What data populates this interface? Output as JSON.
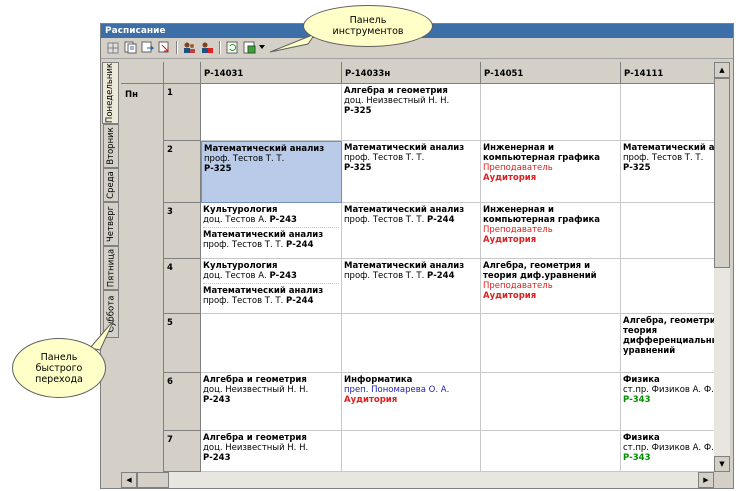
{
  "window": {
    "title": "Расписание"
  },
  "toolbar": {
    "icons": [
      "grid-icon",
      "copy-icon",
      "export-icon",
      "import-icon",
      "users-icon",
      "user-edit-icon",
      "refresh-icon",
      "save-icon",
      "dropdown-arrow-icon"
    ]
  },
  "callouts": {
    "toolbar": "Панель\nинструментов",
    "quicknav": "Панель\nбыстрого\nперехода"
  },
  "days": [
    "Понедельник",
    "Вторник",
    "Среда",
    "Четверг",
    "Пятница",
    "Суббота"
  ],
  "active_day": "Понедельник",
  "grid": {
    "day_label": "Пн",
    "columns": [
      "Р-14031",
      "Р-14033н",
      "Р-14051",
      "Р-14111"
    ],
    "rows": [
      {
        "num": "1",
        "cells": [
          null,
          {
            "entries": [
              {
                "subject": "Алгебра и геометрия",
                "teacher": "доц. Неизвестный Н. Н.",
                "room": "Р-325"
              }
            ]
          },
          null,
          null
        ]
      },
      {
        "num": "2",
        "cells": [
          {
            "selected": true,
            "entries": [
              {
                "subject": "Математический анализ",
                "teacher": "проф. Тестов Т. Т.",
                "room": "Р-325"
              }
            ]
          },
          {
            "entries": [
              {
                "subject": "Математический анализ",
                "teacher": "проф. Тестов Т. Т.",
                "room": "Р-325"
              }
            ]
          },
          {
            "entries": [
              {
                "subject": "Инженерная и",
                "subject2": "компьютерная графика",
                "teacher_red": "Преподаватель",
                "room_red": "Аудитория"
              }
            ]
          },
          {
            "entries": [
              {
                "subject": "Математический ан",
                "teacher": "проф. Тестов Т. Т.",
                "room": "Р-325"
              }
            ]
          }
        ]
      },
      {
        "num": "3",
        "cells": [
          {
            "entries": [
              {
                "subject": "Культурология",
                "teacher": "доц. Тестов А.",
                "room_inline": "Р-243"
              },
              {
                "subject": "Математический анализ",
                "teacher": "проф. Тестов Т. Т.",
                "room_inline": "Р-244"
              }
            ]
          },
          {
            "entries": [
              {
                "subject": "Математический анализ",
                "teacher": "проф. Тестов Т. Т.",
                "room_inline": "Р-244"
              }
            ]
          },
          {
            "entries": [
              {
                "subject": "Инженерная и",
                "subject2": "компьютерная графика",
                "teacher_red": "Преподаватель",
                "room_red": "Аудитория"
              }
            ]
          },
          null
        ]
      },
      {
        "num": "4",
        "cells": [
          {
            "entries": [
              {
                "subject": "Культурология",
                "teacher": "доц. Тестов А.",
                "room_inline": "Р-243"
              },
              {
                "subject": "Математический анализ",
                "teacher": "проф. Тестов Т. Т.",
                "room_inline": "Р-244"
              }
            ]
          },
          {
            "entries": [
              {
                "subject": "Математический анализ",
                "teacher": "проф. Тестов Т. Т.",
                "room_inline": "Р-244"
              }
            ]
          },
          {
            "entries": [
              {
                "subject": "Алгебра, геометрия и",
                "subject2": "теория диф.уравнений",
                "teacher_red": "Преподаватель",
                "room_red": "Аудитория"
              }
            ]
          },
          null
        ]
      },
      {
        "num": "5",
        "cells": [
          null,
          null,
          null,
          {
            "entries": [
              {
                "subject": "Алгебра, геометрия",
                "subject2": "теория",
                "subject3": "дифференциальны",
                "subject4": "уравнений"
              }
            ]
          }
        ]
      },
      {
        "num": "6",
        "cells": [
          {
            "entries": [
              {
                "subject": "Алгебра и геометрия",
                "teacher": "доц. Неизвестный Н. Н.",
                "room": "Р-243"
              }
            ]
          },
          {
            "entries": [
              {
                "subject": "Информатика",
                "teacher_blue": "преп. Пономарева О. А.",
                "room_red": "Аудитория"
              }
            ]
          },
          null,
          {
            "entries": [
              {
                "subject": "Физика",
                "teacher": "ст.пр. Физиков А. Ф.",
                "room_green": "Р-343"
              }
            ]
          }
        ]
      },
      {
        "num": "7",
        "cells": [
          {
            "entries": [
              {
                "subject": "Алгебра и геометрия",
                "teacher": "доц. Неизвестный Н. Н.",
                "room": "Р-243"
              }
            ]
          },
          null,
          null,
          {
            "entries": [
              {
                "subject": "Физика",
                "teacher": "ст.пр. Физиков А. Ф.",
                "room_green": "Р-343"
              }
            ]
          }
        ]
      }
    ]
  }
}
